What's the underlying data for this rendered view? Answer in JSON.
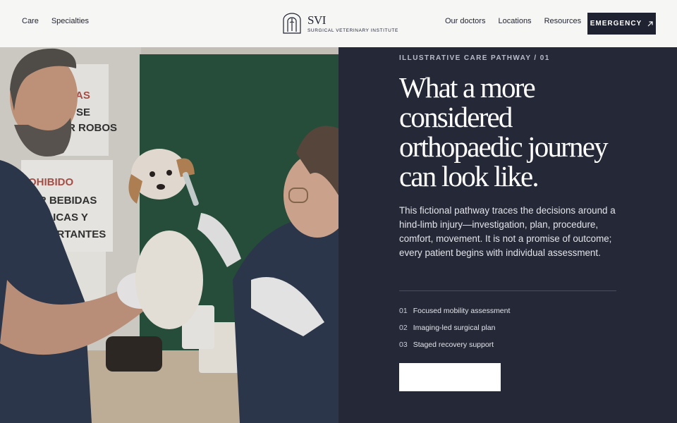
{
  "header": {
    "nav_left": [
      "Care",
      "Specialties"
    ],
    "brand_abbr": "SVI",
    "brand_full": "SURGICAL VETERINARY INSTITUTE",
    "nav_right": [
      "Our doctors",
      "Locations",
      "Resources"
    ],
    "emergency_label": "EMERGENCY",
    "emergency_icon": "arrow-up-right-icon"
  },
  "hero": {
    "eyebrow": "ILLUSTRATIVE CARE PATHWAY / 01",
    "headline": "What a more considered orthopaedic journey can look like.",
    "lede": "This fictional pathway traces the decisions around a hind-limb injury—investigation, plan, procedure, comfort, movement. It is not a promise of outcome; every patient begins with individual assessment.",
    "steps": [
      {
        "num": "01",
        "label": "Focused mobility assessment"
      },
      {
        "num": "02",
        "label": "Imaging-led surgical plan"
      },
      {
        "num": "03",
        "label": "Staged recovery support"
      }
    ],
    "cta_label": ""
  },
  "photo": {
    "sign_lines": [
      "CIAS",
      "SE",
      "R ROBOS",
      "OHIBIDO",
      "AR BEBIDAS",
      "LICAS Y",
      "CORTANTES"
    ]
  },
  "colors": {
    "dark": "#252836",
    "header_bg": "#f6f6f5",
    "button_dark": "#1f2230"
  }
}
